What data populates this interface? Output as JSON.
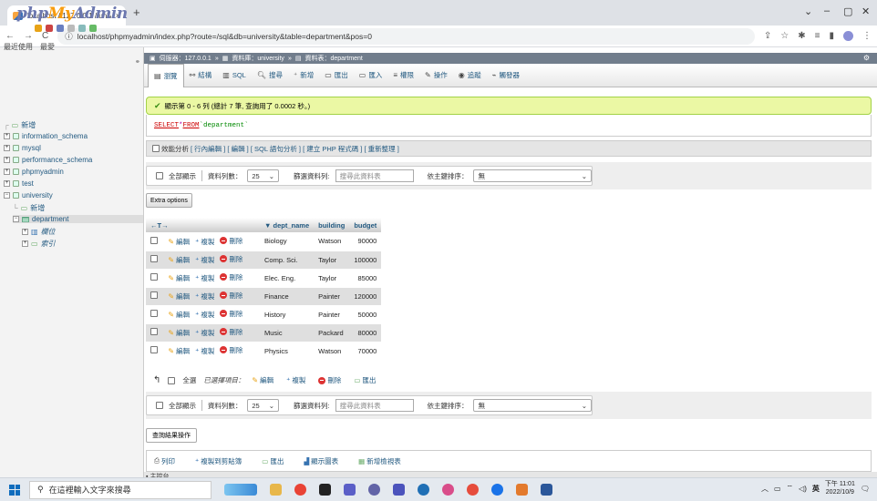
{
  "browser": {
    "tab_title": "localhost / 127.0.0.1 / universit",
    "tab_close": "×",
    "new_tab": "+",
    "url": "localhost/phpmyadmin/index.php?route=/sql&db=university&table=department&pos=0",
    "url_prefix_icon": "ⓘ"
  },
  "nav": {
    "logo_php": "php",
    "logo_my": "My",
    "logo_admin": "Admin",
    "recent": "最近使用",
    "favorites": "最愛",
    "tree": [
      {
        "label": "新增",
        "level": 0,
        "type": "new"
      },
      {
        "label": "information_schema",
        "level": 0,
        "type": "db"
      },
      {
        "label": "mysql",
        "level": 0,
        "type": "db"
      },
      {
        "label": "performance_schema",
        "level": 0,
        "type": "db"
      },
      {
        "label": "phpmyadmin",
        "level": 0,
        "type": "db"
      },
      {
        "label": "test",
        "level": 0,
        "type": "db"
      },
      {
        "label": "university",
        "level": 0,
        "type": "db"
      },
      {
        "label": "新增",
        "level": 1,
        "type": "new"
      },
      {
        "label": "department",
        "level": 1,
        "type": "table"
      },
      {
        "label": "欄位",
        "level": 2,
        "type": "cols"
      },
      {
        "label": "索引",
        "level": 2,
        "type": "idx"
      }
    ]
  },
  "breadcrumb": {
    "server": "伺服器：127.0.0.1",
    "db": "資料庫：university",
    "table": "資料表：department",
    "sep": "»"
  },
  "menu": [
    {
      "label": "瀏覽",
      "icon": "▤",
      "active": true
    },
    {
      "label": "結構",
      "icon": "⚯"
    },
    {
      "label": "SQL",
      "icon": "▥"
    },
    {
      "label": "搜尋",
      "icon": "🔍︎"
    },
    {
      "label": "新增",
      "icon": "⁺"
    },
    {
      "label": "匯出",
      "icon": "▭"
    },
    {
      "label": "匯入",
      "icon": "▭"
    },
    {
      "label": "權限",
      "icon": "≡"
    },
    {
      "label": "操作",
      "icon": "✎"
    },
    {
      "label": "追蹤",
      "icon": "◉"
    },
    {
      "label": "觸發器",
      "icon": "⌁"
    }
  ],
  "result": {
    "message": "顯示第 0 - 6 列 (總計 7 筆, 查詢用了 0.0002 秒。)",
    "sql_select": "SELECT",
    "sql_star": " * ",
    "sql_from": "FROM",
    "sql_table": " `department`",
    "profiling": "效能分析",
    "profiling_links": "[ 行內編輯 ] [ 編輯 ] [ SQL 語句分析 ] [ 建立 PHP 程式碼 ] [ 重新整理 ]"
  },
  "navbar": {
    "show_all": "全部顯示",
    "rows_label": "資料列數：",
    "rows_value": "25",
    "filter_label": "篩選資料列:",
    "filter_placeholder": "搜尋此資料表",
    "sort_label": "依主鍵排序：",
    "sort_value": "無"
  },
  "extra_options": "Extra options",
  "grid": {
    "resize_header": "←T→",
    "columns": [
      "dept_name",
      "building",
      "budget"
    ],
    "sort_indicator": "▼",
    "action_edit": "編輯",
    "action_copy": "複製",
    "action_delete": "刪除",
    "rows": [
      {
        "dept_name": "Biology",
        "building": "Watson",
        "budget": "90000"
      },
      {
        "dept_name": "Comp. Sci.",
        "building": "Taylor",
        "budget": "100000"
      },
      {
        "dept_name": "Elec. Eng.",
        "building": "Taylor",
        "budget": "85000"
      },
      {
        "dept_name": "Finance",
        "building": "Painter",
        "budget": "120000"
      },
      {
        "dept_name": "History",
        "building": "Painter",
        "budget": "50000"
      },
      {
        "dept_name": "Music",
        "building": "Packard",
        "budget": "80000"
      },
      {
        "dept_name": "Physics",
        "building": "Watson",
        "budget": "70000"
      }
    ]
  },
  "with_selected": {
    "check_all": "全選",
    "label": "已選擇項目：",
    "edit": "編輯",
    "copy": "複製",
    "delete": "刪除",
    "export": "匯出"
  },
  "query_ops": {
    "legend": "查詢結果操作",
    "print": "列印",
    "copy_clipboard": "複製到剪貼簿",
    "export": "匯出",
    "chart": "顯示圖表",
    "create_view": "新增檢視表",
    "console": "主控台"
  },
  "taskbar": {
    "search_placeholder": "在這裡輸入文字來搜尋",
    "lang": "英",
    "time": "下午 11:01",
    "date": "2022/10/9"
  }
}
